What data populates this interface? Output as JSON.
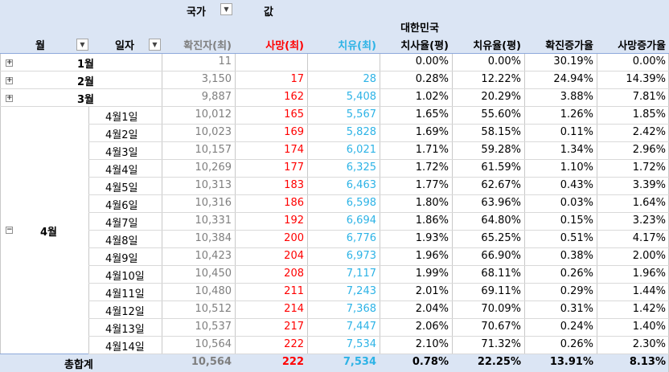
{
  "header": {
    "filter_label": "국가",
    "filter_icon": "filter-dropdown-icon",
    "values_label": "값",
    "col_month": "월",
    "col_day": "일자",
    "col_confirmed": "확진자(최)",
    "col_deaths": "사망(최)",
    "col_recovered": "치유(최)",
    "country": "대한민국",
    "col_fatality": "치사율(평)",
    "col_recovery": "치유율(평)",
    "col_conf_growth": "확진증가율",
    "col_death_growth": "사망증가율"
  },
  "colors": {
    "deaths": "#ff0000",
    "recovered": "#2db3e6",
    "header_bg": "#dbe5f4"
  },
  "collapsed_rows": [
    {
      "month": "1월",
      "confirmed": "11",
      "deaths": "",
      "recovered": "",
      "fatality": "0.00%",
      "recovery": "0.00%",
      "conf_growth": "30.19%",
      "death_growth": "0.00%"
    },
    {
      "month": "2월",
      "confirmed": "3,150",
      "deaths": "17",
      "recovered": "28",
      "fatality": "0.28%",
      "recovery": "12.22%",
      "conf_growth": "24.94%",
      "death_growth": "14.39%"
    },
    {
      "month": "3월",
      "confirmed": "9,887",
      "deaths": "162",
      "recovered": "5,408",
      "fatality": "1.02%",
      "recovery": "20.29%",
      "conf_growth": "3.88%",
      "death_growth": "7.81%"
    }
  ],
  "expanded_month": "4월",
  "april_rows": [
    {
      "day": "4월1일",
      "confirmed": "10,012",
      "deaths": "165",
      "recovered": "5,567",
      "fatality": "1.65%",
      "recovery": "55.60%",
      "conf_growth": "1.26%",
      "death_growth": "1.85%"
    },
    {
      "day": "4월2일",
      "confirmed": "10,023",
      "deaths": "169",
      "recovered": "5,828",
      "fatality": "1.69%",
      "recovery": "58.15%",
      "conf_growth": "0.11%",
      "death_growth": "2.42%"
    },
    {
      "day": "4월3일",
      "confirmed": "10,157",
      "deaths": "174",
      "recovered": "6,021",
      "fatality": "1.71%",
      "recovery": "59.28%",
      "conf_growth": "1.34%",
      "death_growth": "2.96%"
    },
    {
      "day": "4월4일",
      "confirmed": "10,269",
      "deaths": "177",
      "recovered": "6,325",
      "fatality": "1.72%",
      "recovery": "61.59%",
      "conf_growth": "1.10%",
      "death_growth": "1.72%"
    },
    {
      "day": "4월5일",
      "confirmed": "10,313",
      "deaths": "183",
      "recovered": "6,463",
      "fatality": "1.77%",
      "recovery": "62.67%",
      "conf_growth": "0.43%",
      "death_growth": "3.39%"
    },
    {
      "day": "4월6일",
      "confirmed": "10,316",
      "deaths": "186",
      "recovered": "6,598",
      "fatality": "1.80%",
      "recovery": "63.96%",
      "conf_growth": "0.03%",
      "death_growth": "1.64%"
    },
    {
      "day": "4월7일",
      "confirmed": "10,331",
      "deaths": "192",
      "recovered": "6,694",
      "fatality": "1.86%",
      "recovery": "64.80%",
      "conf_growth": "0.15%",
      "death_growth": "3.23%"
    },
    {
      "day": "4월8일",
      "confirmed": "10,384",
      "deaths": "200",
      "recovered": "6,776",
      "fatality": "1.93%",
      "recovery": "65.25%",
      "conf_growth": "0.51%",
      "death_growth": "4.17%"
    },
    {
      "day": "4월9일",
      "confirmed": "10,423",
      "deaths": "204",
      "recovered": "6,973",
      "fatality": "1.96%",
      "recovery": "66.90%",
      "conf_growth": "0.38%",
      "death_growth": "2.00%"
    },
    {
      "day": "4월10일",
      "confirmed": "10,450",
      "deaths": "208",
      "recovered": "7,117",
      "fatality": "1.99%",
      "recovery": "68.11%",
      "conf_growth": "0.26%",
      "death_growth": "1.96%"
    },
    {
      "day": "4월11일",
      "confirmed": "10,480",
      "deaths": "211",
      "recovered": "7,243",
      "fatality": "2.01%",
      "recovery": "69.11%",
      "conf_growth": "0.29%",
      "death_growth": "1.44%"
    },
    {
      "day": "4월12일",
      "confirmed": "10,512",
      "deaths": "214",
      "recovered": "7,368",
      "fatality": "2.04%",
      "recovery": "70.09%",
      "conf_growth": "0.31%",
      "death_growth": "1.42%"
    },
    {
      "day": "4월13일",
      "confirmed": "10,537",
      "deaths": "217",
      "recovered": "7,447",
      "fatality": "2.06%",
      "recovery": "70.67%",
      "conf_growth": "0.24%",
      "death_growth": "1.40%"
    },
    {
      "day": "4월14일",
      "confirmed": "10,564",
      "deaths": "222",
      "recovered": "7,534",
      "fatality": "2.10%",
      "recovery": "71.32%",
      "conf_growth": "0.26%",
      "death_growth": "2.30%"
    }
  ],
  "grand_total": {
    "label": "총합계",
    "confirmed": "10,564",
    "deaths": "222",
    "recovered": "7,534",
    "fatality": "0.78%",
    "recovery": "22.25%",
    "conf_growth": "13.91%",
    "death_growth": "8.13%"
  }
}
